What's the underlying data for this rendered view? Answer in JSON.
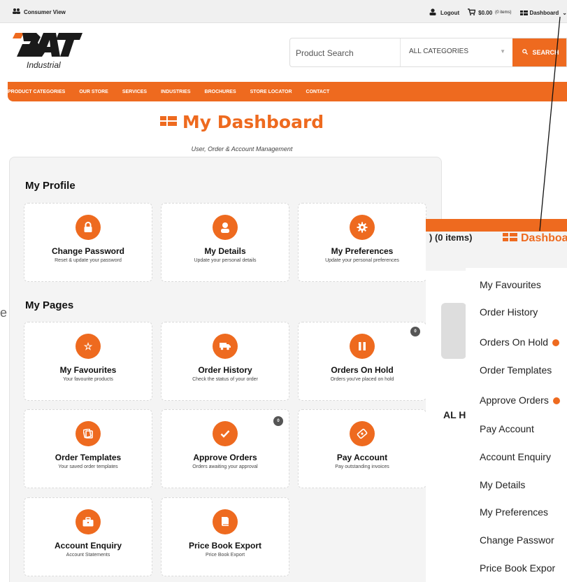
{
  "topbar": {
    "consumer_view": "Consumer View",
    "logout": "Logout",
    "cart_total": "$0.00",
    "cart_items": "(0 items)",
    "dashboard": "Dashboard"
  },
  "header": {
    "logo_main": "BAT",
    "logo_sub": "Industrial",
    "search_placeholder": "Product Search",
    "category_select": "ALL CATEGORIES",
    "search_button": "SEARCH"
  },
  "nav": [
    "PRODUCT CATEGORIES",
    "OUR STORE",
    "SERVICES",
    "INDUSTRIES",
    "BROCHURES",
    "STORE LOCATOR",
    "CONTACT"
  ],
  "page": {
    "title": "My Dashboard",
    "subtitle": "User, Order & Account Management"
  },
  "profile": {
    "heading": "My Profile",
    "cards": [
      {
        "title": "Change Password",
        "desc": "Reset & update your password",
        "icon": "lock-icon",
        "glyph": "🔒"
      },
      {
        "title": "My Details",
        "desc": "Update your personal details",
        "icon": "user-icon",
        "glyph": "👤"
      },
      {
        "title": "My Preferences",
        "desc": "Update your personal preferences",
        "icon": "gear-icon",
        "glyph": "⚙"
      }
    ]
  },
  "pages": {
    "heading": "My Pages",
    "cards": [
      {
        "title": "My Favourites",
        "desc": "Your favourite products",
        "icon": "star-icon",
        "glyph": "☆"
      },
      {
        "title": "Order History",
        "desc": "Check the status of your order",
        "icon": "truck-icon",
        "glyph": "🚚"
      },
      {
        "title": "Orders On Hold",
        "desc": "Orders you've placed on hold",
        "icon": "pause-icon",
        "glyph": "❚❚",
        "badge": "0"
      },
      {
        "title": "Order Templates",
        "desc": "Your saved order templates",
        "icon": "templates-icon",
        "glyph": "❏"
      },
      {
        "title": "Approve Orders",
        "desc": "Orders awaiting your approval",
        "icon": "check-icon",
        "glyph": "✓",
        "badge": "0"
      },
      {
        "title": "Pay Account",
        "desc": "Pay outstanding invoices",
        "icon": "payment-icon",
        "glyph": "◈"
      },
      {
        "title": "Account Enquiry",
        "desc": "Account Statements",
        "icon": "briefcase-icon",
        "glyph": "💼"
      },
      {
        "title": "Price Book Export",
        "desc": "Price Book Export",
        "icon": "book-icon",
        "glyph": "📘"
      }
    ]
  },
  "zoom": {
    "items_text": ") (0 items)",
    "dashboard_label": "Dashboar",
    "behind_text": "AL H",
    "menu": [
      "My Favourites",
      "Order History",
      "Orders On Hold",
      "Order Templates",
      "Approve Orders",
      "Pay Account",
      "Account Enquiry",
      "My Details",
      "My Preferences",
      "Change Passwor",
      "Price Book Expor"
    ]
  },
  "stray_text": "e",
  "colors": {
    "accent": "#ee6a1f",
    "panel": "#f4f4f4",
    "badge": "#555555"
  }
}
